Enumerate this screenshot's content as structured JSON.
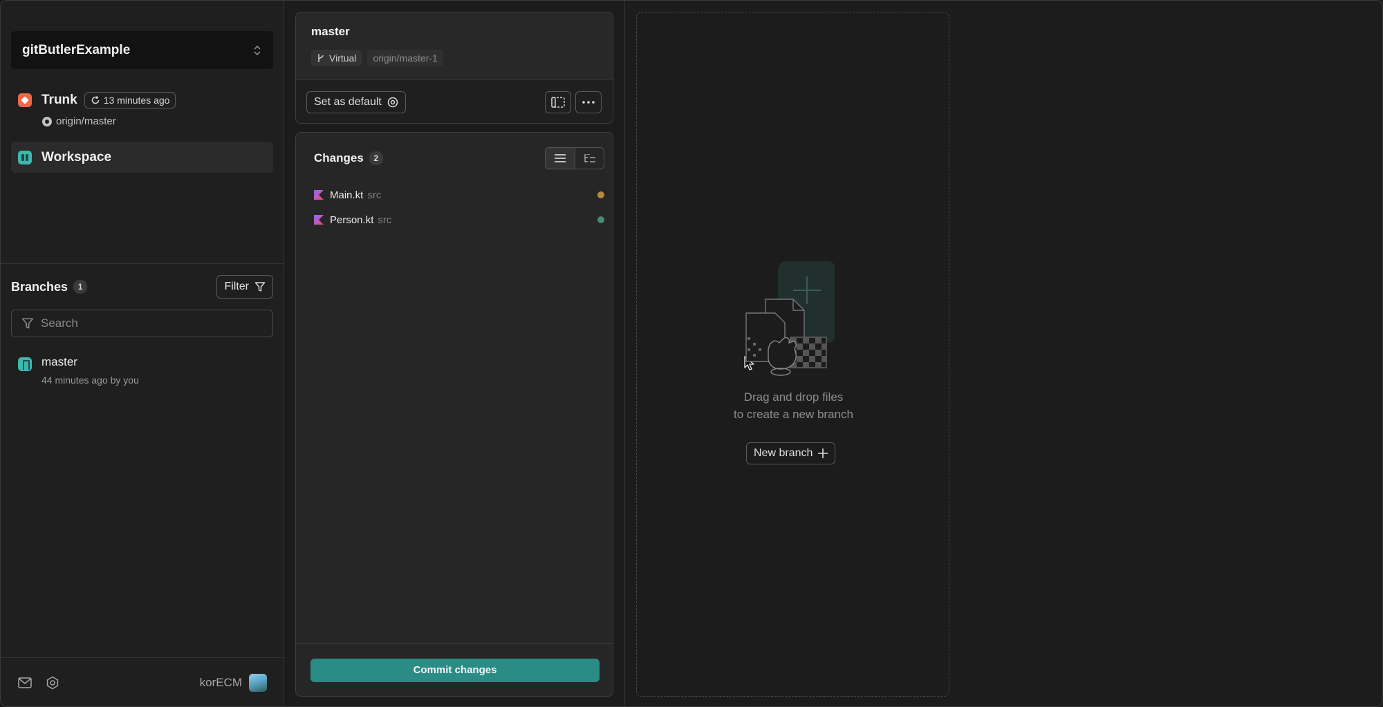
{
  "project": {
    "name": "gitButlerExample"
  },
  "trunk": {
    "label": "Trunk",
    "updated": "13 minutes ago",
    "remote": "origin/master"
  },
  "workspace": {
    "label": "Workspace"
  },
  "branches": {
    "title": "Branches",
    "count": "1",
    "filter_label": "Filter",
    "search_placeholder": "Search",
    "items": [
      {
        "name": "master",
        "meta": "44 minutes ago by you"
      }
    ]
  },
  "footer": {
    "username": "korECM"
  },
  "branch_card": {
    "title": "master",
    "tag_virtual": "Virtual",
    "tag_remote": "origin/master-1",
    "set_default_label": "Set as default"
  },
  "changes": {
    "title": "Changes",
    "count": "2",
    "files": [
      {
        "name": "Main.kt",
        "path": "src",
        "status_color": "#b98a3c"
      },
      {
        "name": "Person.kt",
        "path": "src",
        "status_color": "#4a8a74"
      }
    ],
    "commit_label": "Commit changes"
  },
  "dropzone": {
    "line1": "Drag and drop files",
    "line2": "to create a new branch",
    "new_branch_label": "New branch"
  },
  "colors": {
    "accent": "#2b8c86",
    "trunk_icon": "#f06748",
    "workspace_icon": "#3fb7ad"
  }
}
